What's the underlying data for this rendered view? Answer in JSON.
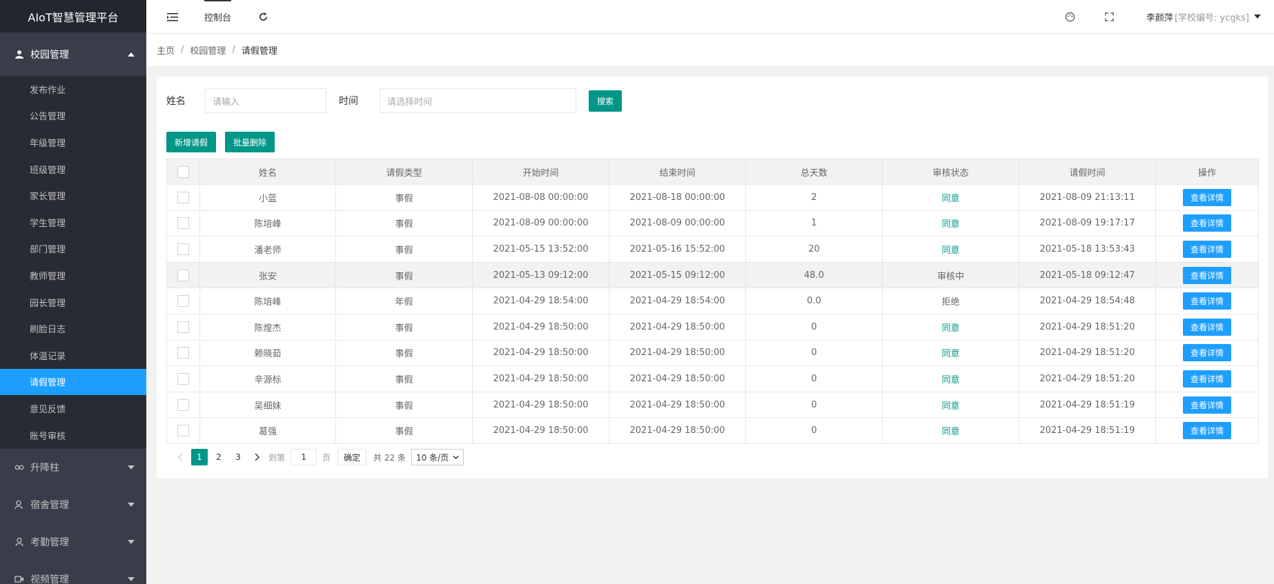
{
  "sidebar": {
    "logo": "AIoT智慧管理平台",
    "open_group": "校园管理",
    "items": [
      "发布作业",
      "公告管理",
      "年级管理",
      "班级管理",
      "家长管理",
      "学生管理",
      "部门管理",
      "教师管理",
      "园长管理",
      "刷脸日志",
      "体温记录",
      "请假管理",
      "意见反馈",
      "账号审核"
    ],
    "active_index": 11,
    "closed_groups": [
      "升降柱",
      "宿舍管理",
      "考勤管理",
      "视频管理"
    ]
  },
  "topbar": {
    "tab": "控制台",
    "user_name": "李颜萍",
    "school": "[学校编号: ycgks]"
  },
  "breadcrumb": [
    "主页",
    "校园管理",
    "请假管理"
  ],
  "search": {
    "name_label": "姓名",
    "name_placeholder": "请输入",
    "time_label": "时间",
    "time_placeholder": "请选择时间",
    "search_button": "搜索"
  },
  "actions": {
    "add": "新增请假",
    "batch_delete": "批量删除"
  },
  "table": {
    "headers": [
      "姓名",
      "请假类型",
      "开始时间",
      "结束时间",
      "总天数",
      "审核状态",
      "请假时间",
      "操作"
    ],
    "detail_label": "查看详情",
    "rows": [
      [
        "小蓝",
        "事假",
        "2021-08-08 00:00:00",
        "2021-08-18 00:00:00",
        "2",
        "同意",
        "2021-08-09 21:13:11"
      ],
      [
        "陈培峰",
        "事假",
        "2021-08-09 00:00:00",
        "2021-08-09 00:00:00",
        "1",
        "同意",
        "2021-08-09 19:17:17"
      ],
      [
        "潘老师",
        "事假",
        "2021-05-15 13:52:00",
        "2021-05-16 15:52:00",
        "20",
        "同意",
        "2021-05-18 13:53:43"
      ],
      [
        "张安",
        "事假",
        "2021-05-13 09:12:00",
        "2021-05-15 09:12:00",
        "48.0",
        "审核中",
        "2021-05-18 09:12:47"
      ],
      [
        "陈培峰",
        "年假",
        "2021-04-29 18:54:00",
        "2021-04-29 18:54:00",
        "0.0",
        "拒绝",
        "2021-04-29 18:54:48"
      ],
      [
        "陈煌杰",
        "事假",
        "2021-04-29 18:50:00",
        "2021-04-29 18:50:00",
        "0",
        "同意",
        "2021-04-29 18:51:20"
      ],
      [
        "赖晓茹",
        "事假",
        "2021-04-29 18:50:00",
        "2021-04-29 18:50:00",
        "0",
        "同意",
        "2021-04-29 18:51:20"
      ],
      [
        "辛源标",
        "事假",
        "2021-04-29 18:50:00",
        "2021-04-29 18:50:00",
        "0",
        "同意",
        "2021-04-29 18:51:20"
      ],
      [
        "吴细妹",
        "事假",
        "2021-04-29 18:50:00",
        "2021-04-29 18:50:00",
        "0",
        "同意",
        "2021-04-29 18:51:19"
      ],
      [
        "葛强",
        "事假",
        "2021-04-29 18:50:00",
        "2021-04-29 18:50:00",
        "0",
        "同意",
        "2021-04-29 18:51:19"
      ]
    ],
    "highlight_row": 3
  },
  "pager": {
    "pages": [
      "1",
      "2",
      "3"
    ],
    "current": "1",
    "goto_label": "到第",
    "goto_value": "1",
    "page_unit": "页",
    "confirm": "确定",
    "total": "共 22 条",
    "per_page": "10 条/页"
  },
  "colors": {
    "accent": "#009688",
    "blue": "#1e9fff",
    "sidebar": "#393d49"
  }
}
